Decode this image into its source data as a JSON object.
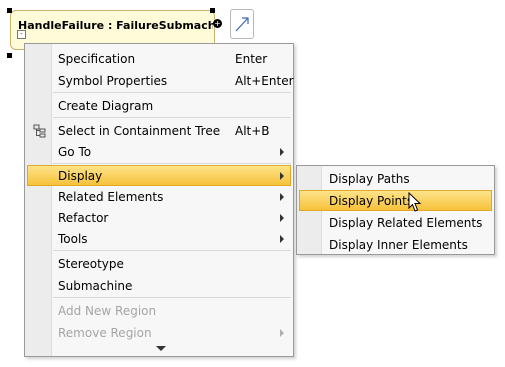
{
  "diagram": {
    "state_title": "HandleFailure : FailureSubmachine"
  },
  "context_menu": {
    "items": [
      {
        "label": "Specification",
        "shortcut": "Enter"
      },
      {
        "label": "Symbol Properties",
        "shortcut": "Alt+Enter"
      },
      {
        "label": "Create Diagram"
      },
      {
        "label": "Select in Containment Tree",
        "shortcut": "Alt+B",
        "icon": "containment-tree-icon"
      },
      {
        "label": "Go To",
        "submenu": true
      },
      {
        "label": "Display",
        "submenu": true,
        "highlighted": true
      },
      {
        "label": "Related Elements",
        "submenu": true
      },
      {
        "label": "Refactor",
        "submenu": true
      },
      {
        "label": "Tools",
        "submenu": true
      },
      {
        "label": "Stereotype"
      },
      {
        "label": "Submachine"
      },
      {
        "label": "Add New Region",
        "disabled": true
      },
      {
        "label": "Remove Region",
        "disabled": true,
        "submenu": true
      }
    ]
  },
  "display_submenu": {
    "items": [
      {
        "label": "Display Paths"
      },
      {
        "label": "Display Points",
        "highlighted": true
      },
      {
        "label": "Display Related Elements"
      },
      {
        "label": "Display Inner Elements"
      }
    ]
  },
  "colors": {
    "highlight_top": "#fde38a",
    "highlight_bottom": "#f6c23b",
    "state_fill": "#fffbd9"
  }
}
